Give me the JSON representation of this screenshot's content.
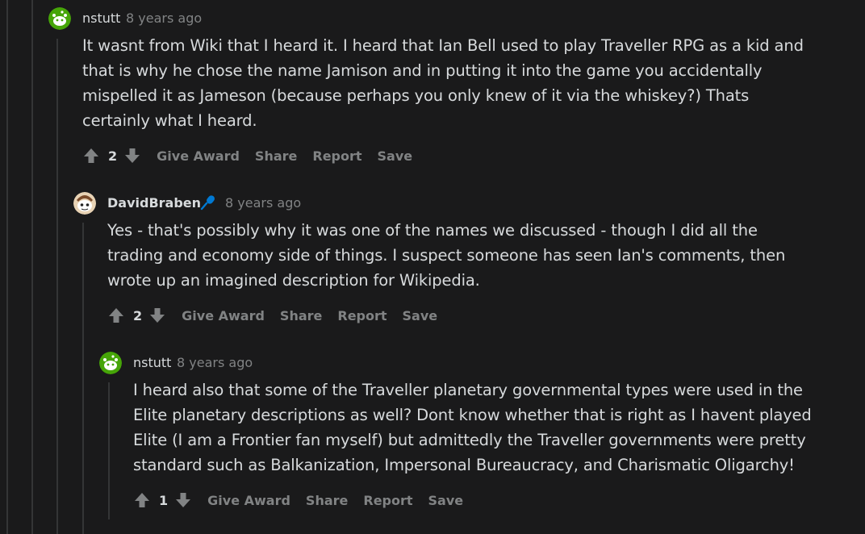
{
  "comments": [
    {
      "username": "nstutt",
      "time": "8 years ago",
      "body": "It wasnt from Wiki that I heard it. I heard that Ian Bell used to play Traveller RPG as a kid and\nthat is why he chose the name Jamison and in putting it into the game you accidentally\nmispelled it as Jameson (because perhaps you only knew of it via the whiskey?) Thats\ncertainly what I heard.",
      "score": "2",
      "actions": {
        "award": "Give Award",
        "share": "Share",
        "report": "Report",
        "save": "Save"
      }
    },
    {
      "username": "DavidBraben",
      "time": "8 years ago",
      "body": "Yes - that's possibly why it was one of the names we discussed - though I did all the\ntrading and economy side of things. I suspect someone has seen Ian's comments, then\nwrote up an imagined description for Wikipedia.",
      "score": "2",
      "actions": {
        "award": "Give Award",
        "share": "Share",
        "report": "Report",
        "save": "Save"
      }
    },
    {
      "username": "nstutt",
      "time": "8 years ago",
      "body": "I heard also that some of the Traveller planetary governmental types were used in the\nElite planetary descriptions as well? Dont know whether that is right as I havent played\nElite (I am a Frontier fan myself) but admittedly the Traveller governments were pretty\nstandard such as Balkanization, Impersonal Bureaucracy, and Charismatic Oligarchy!",
      "score": "1",
      "actions": {
        "award": "Give Award",
        "share": "Share",
        "report": "Report",
        "save": "Save"
      }
    }
  ],
  "colors": {
    "background": "#1a1a1b",
    "text": "#d7dadc",
    "muted": "#818384",
    "thread_line": "#343536",
    "avatar_green": "#46a508",
    "mic_blue": "#0079d3"
  }
}
